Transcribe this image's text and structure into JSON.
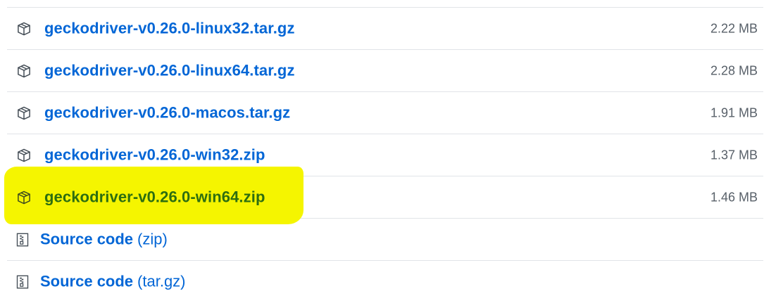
{
  "assets": [
    {
      "name": "geckodriver-v0.26.0-linux32.tar.gz",
      "size": "2.22 MB",
      "icon": "package-icon",
      "highlighted": false
    },
    {
      "name": "geckodriver-v0.26.0-linux64.tar.gz",
      "size": "2.28 MB",
      "icon": "package-icon",
      "highlighted": false
    },
    {
      "name": "geckodriver-v0.26.0-macos.tar.gz",
      "size": "1.91 MB",
      "icon": "package-icon",
      "highlighted": false
    },
    {
      "name": "geckodriver-v0.26.0-win32.zip",
      "size": "1.37 MB",
      "icon": "package-icon",
      "highlighted": false
    },
    {
      "name": "geckodriver-v0.26.0-win64.zip",
      "size": "1.46 MB",
      "icon": "package-icon",
      "highlighted": true
    }
  ],
  "source_code": [
    {
      "label": "Source code",
      "ext": "(zip)",
      "icon": "file-zip-icon"
    },
    {
      "label": "Source code",
      "ext": "(tar.gz)",
      "icon": "file-zip-icon"
    }
  ],
  "colors": {
    "link": "#0366d6",
    "highlight": "#f5f500",
    "highlighted_link": "#2d6e10",
    "size_text": "#586069",
    "divider": "#e1e4e8"
  }
}
